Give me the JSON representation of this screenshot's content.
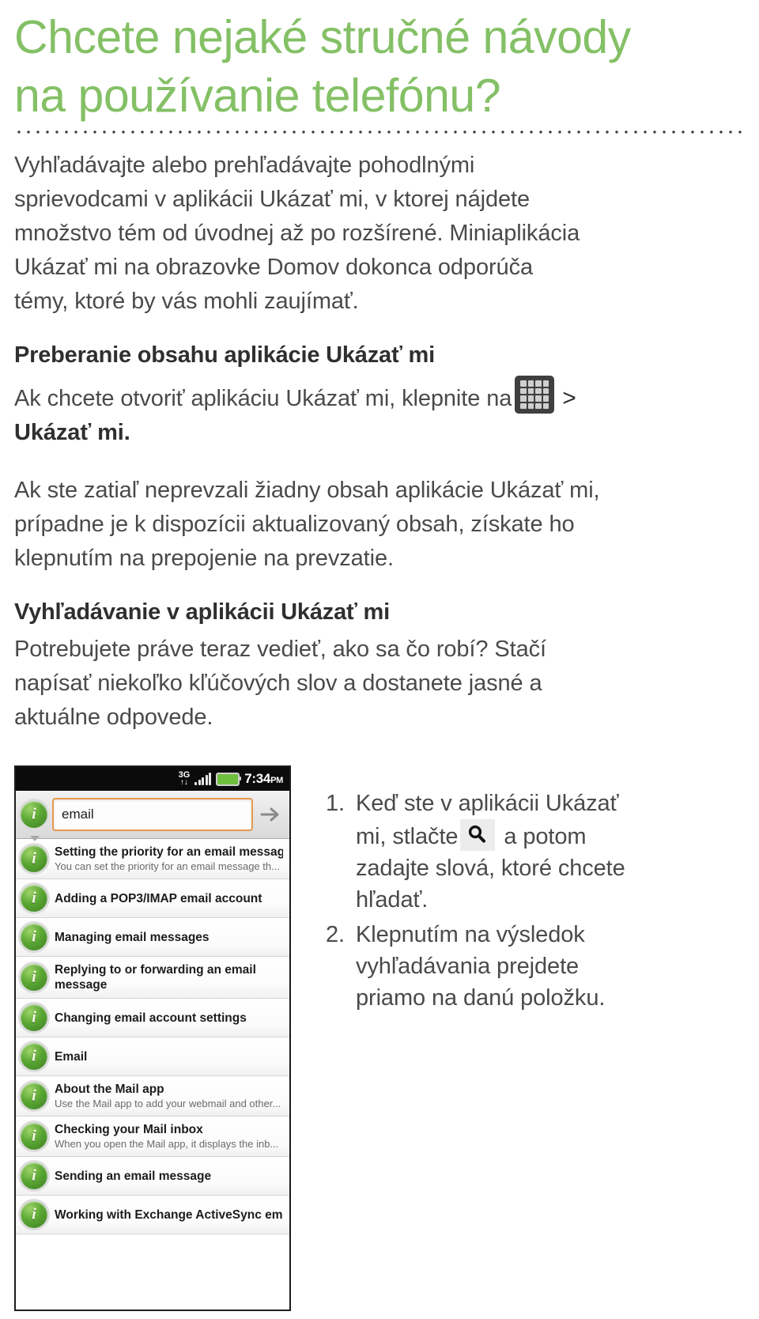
{
  "colors": {
    "title_green": "#84c065",
    "body_gray": "#4a4a4a",
    "heading_dark": "#2f2f2f",
    "search_field_border": "#e79a4e",
    "badge_green": "#5aa733",
    "statusbar_black": "#0b0b0b"
  },
  "page": {
    "title": "Chcete nejaké stručné návody\nna používanie telefónu?",
    "intro": "Vyhľadávajte alebo prehľadávajte pohodlnými\nsprievodcami v aplikácii Ukázať mi, v ktorej nájdete\nmnožstvo tém od úvodnej až po rozšírené. Miniaplikácia\nUkázať mi na obrazovke Domov dokonca odporúča\ntémy, ktoré by vás mohli zaujímať."
  },
  "section_one": {
    "heading": "Preberanie obsahu aplikácie Ukázať mi",
    "para_lead": "Ak chcete otvoriť aplikáciu Ukázať mi, klepnite na",
    "chevron": ">",
    "para_bold_tail": "Ukázať mi.",
    "para_body": "Ak ste zatiaľ neprevzali žiadny obsah aplikácie Ukázať mi,\nprípadne je k dispozícii aktualizovaný obsah, získate ho\nklepnutím na prepojenie na prevzatie.",
    "apps_icon_name": "apps-grid-icon"
  },
  "section_two": {
    "heading": "Vyhľadávanie v aplikácii Ukázať mi",
    "para_body": "Potrebujete práve teraz vedieť, ako sa čo robí? Stačí\nnapísať niekoľko kľúčových slov a dostanete jasné a\naktuálne odpovede."
  },
  "steps": [
    {
      "number": "1.",
      "text_before": "Keď ste v aplikácii Ukázať\nmi, stlačte",
      "icon": "search-icon",
      "text_after": " a potom\nzadajte slová, ktoré chcete\nhľadať."
    },
    {
      "number": "2.",
      "text_before": "Klepnutím na výsledok\nvyhľadávania prejdete\npriamo na danú položku.",
      "icon": "",
      "text_after": ""
    }
  ],
  "phone": {
    "statusbar": {
      "network": "3G",
      "network_sub": "↑↓",
      "signal_icon": "signal-bars-icon",
      "battery_icon": "battery-icon",
      "time": "7:34",
      "time_meridiem": "PM"
    },
    "search": {
      "value": "email",
      "go_icon": "arrow-right-icon",
      "badge_icon": "info-badge-icon"
    },
    "results": [
      {
        "title": "Setting the priority for an email message",
        "subtitle": "You can set the priority for an email message th...",
        "wrap": false
      },
      {
        "title": "Adding a POP3/IMAP email account",
        "subtitle": "",
        "wrap": false
      },
      {
        "title": "Managing email messages",
        "subtitle": "",
        "wrap": false
      },
      {
        "title": "Replying to or forwarding an email message",
        "subtitle": "",
        "wrap": true
      },
      {
        "title": "Changing email account settings",
        "subtitle": "",
        "wrap": false
      },
      {
        "title": "Email",
        "subtitle": "",
        "wrap": false
      },
      {
        "title": "About the Mail app",
        "subtitle": "Use the Mail app to add your webmail and other...",
        "wrap": false
      },
      {
        "title": "Checking your Mail inbox",
        "subtitle": "When you open the Mail app, it displays the inb...",
        "wrap": false
      },
      {
        "title": "Sending an email message",
        "subtitle": "",
        "wrap": false
      },
      {
        "title": "Working with Exchange ActiveSync email",
        "subtitle": "",
        "wrap": false
      }
    ]
  }
}
